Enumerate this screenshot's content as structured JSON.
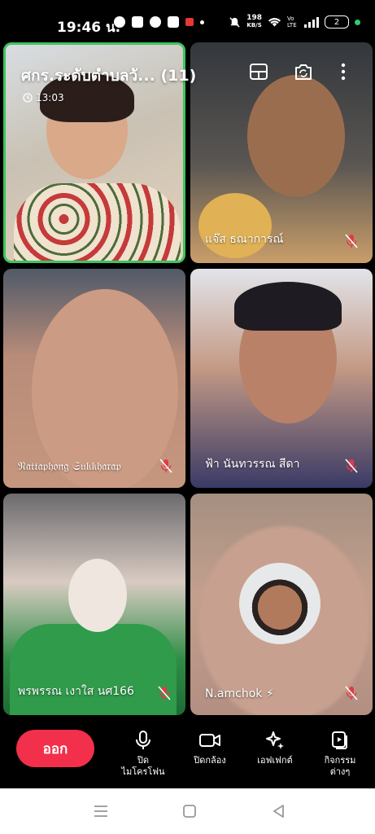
{
  "status_bar": {
    "time": "19:46 น.",
    "network_speed_value": "198",
    "network_speed_unit": "KB/S",
    "volte": "Vo LTE",
    "battery": "2"
  },
  "meeting": {
    "title": "ศกร.ระดับตำบลวั... (11)",
    "timer": "13:03"
  },
  "participants": [
    {
      "name": "",
      "muted": false,
      "active_speaker": true
    },
    {
      "name": "แจ๊ส ธณาการณ์",
      "muted": true
    },
    {
      "name": "𝔑𝔞𝔱𝔱𝔞𝔭𝔥𝔬𝔫𝔤 𝔖𝔲𝔨𝔨𝔥𝔞𝔯𝔞𝔭",
      "muted": true
    },
    {
      "name": "ฟ้า นันทวรรณ สีดา",
      "muted": true
    },
    {
      "name": "พรพรรณ เงาใส นศ166",
      "muted": true
    },
    {
      "name": "N.amchok ⚡",
      "muted": true
    }
  ],
  "controls": {
    "leave": "ออก",
    "mute": "ปิด\nไมโครโฟน",
    "camera": "ปิดกล้อง",
    "effects": "เอฟเฟกต์",
    "activities": "กิจกรรม\nต่างๆ"
  },
  "colors": {
    "leave_button": "#f2304b",
    "active_speaker_border": "#3ec45c",
    "mic_off": "#e53945"
  }
}
